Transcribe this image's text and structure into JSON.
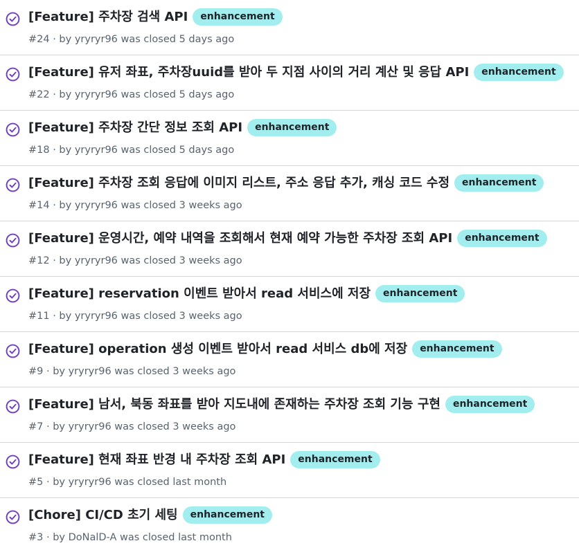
{
  "colors": {
    "closed_icon": "#6f42c1",
    "label_enhancement_bg": "#a2eeef",
    "title_text": "#1f2328",
    "meta_text": "#59636e",
    "divider": "#d0d7de"
  },
  "icons": {
    "status": "issue-closed-check-circle-icon"
  },
  "issues": [
    {
      "title": "[Feature] 주차장 검색 API",
      "label": "enhancement",
      "meta": "#24 · by yryryr96 was closed 5 days ago"
    },
    {
      "title": "[Feature] 유저 좌표, 주차장uuid를 받아 두 지점 사이의 거리 계산 및 응답 API",
      "label": "enhancement",
      "meta": "#22 · by yryryr96 was closed 5 days ago"
    },
    {
      "title": "[Feature] 주차장 간단 정보 조회 API",
      "label": "enhancement",
      "meta": "#18 · by yryryr96 was closed 5 days ago"
    },
    {
      "title": "[Feature] 주차장 조회 응답에 이미지 리스트, 주소 응답 추가, 캐싱 코드 수정",
      "label": "enhancement",
      "meta": "#14 · by yryryr96 was closed 3 weeks ago"
    },
    {
      "title": "[Feature] 운영시간, 예약 내역을 조회해서 현재 예약 가능한 주차장 조회 API",
      "label": "enhancement",
      "meta": "#12 · by yryryr96 was closed 3 weeks ago"
    },
    {
      "title": "[Feature] reservation 이벤트 받아서 read 서비스에 저장",
      "label": "enhancement",
      "meta": "#11 · by yryryr96 was closed 3 weeks ago"
    },
    {
      "title": "[Feature] operation 생성 이벤트 받아서 read 서비스 db에 저장",
      "label": "enhancement",
      "meta": "#9 · by yryryr96 was closed 3 weeks ago"
    },
    {
      "title": "[Feature] 남서, 북동 좌표를 받아 지도내에 존재하는 주차장 조회 기능 구현",
      "label": "enhancement",
      "meta": "#7 · by yryryr96 was closed 3 weeks ago"
    },
    {
      "title": "[Feature] 현재 좌표 반경 내 주차장 조회 API",
      "label": "enhancement",
      "meta": "#5 · by yryryr96 was closed last month"
    },
    {
      "title": "[Chore] CI/CD 초기 세팅",
      "label": "enhancement",
      "meta": "#3 · by DoNalD-A was closed last month"
    }
  ]
}
